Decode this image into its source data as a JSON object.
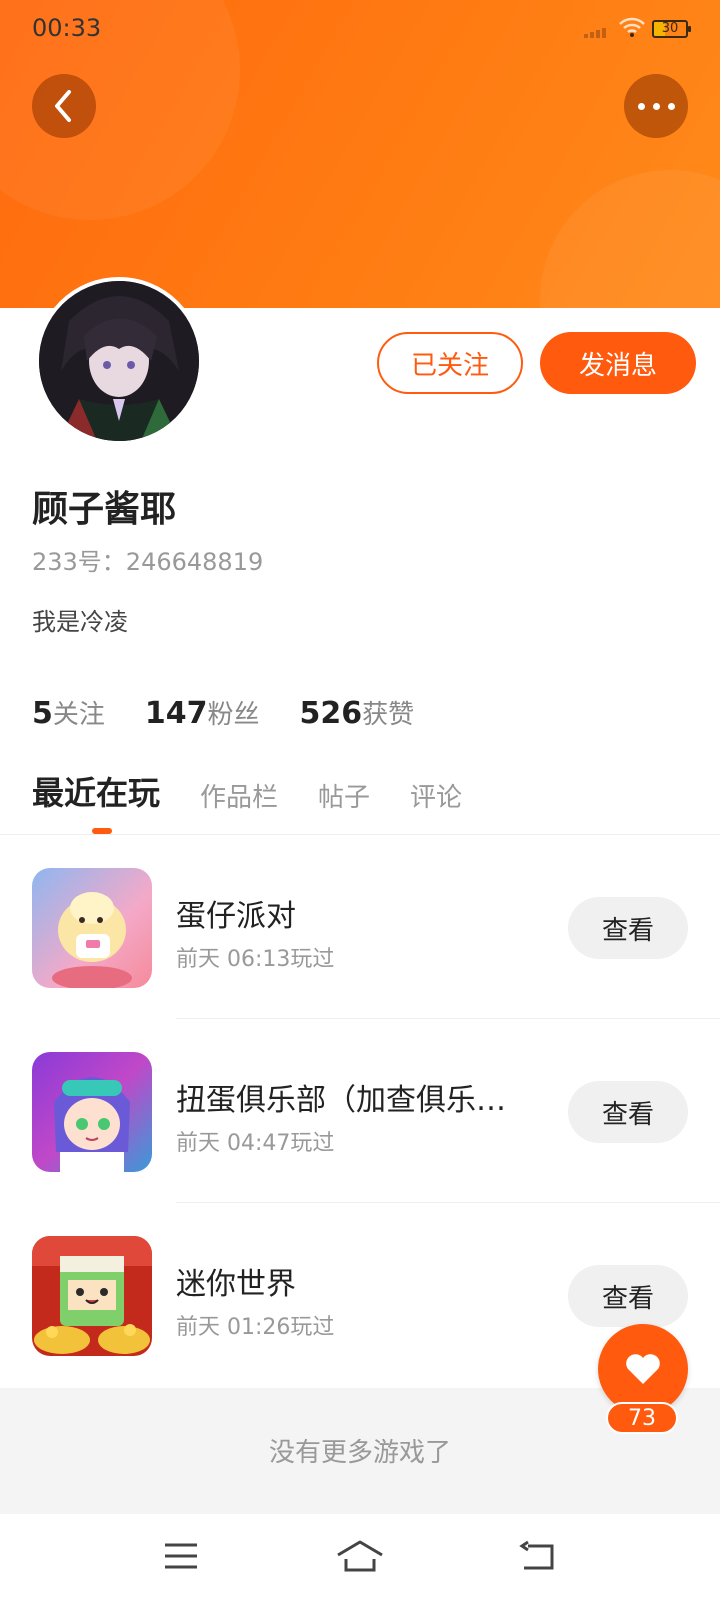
{
  "status_bar": {
    "time": "00:33",
    "battery": "30"
  },
  "header": {
    "back_icon": "chevron-left-icon",
    "more_icon": "more-horizontal-icon",
    "accent": "#ff5a0e"
  },
  "profile": {
    "name": "顾子酱耶",
    "uid": "233号：246648819",
    "bio": "我是冷凌",
    "follow_button": "已关注",
    "message_button": "发消息",
    "stats": [
      {
        "value": "5",
        "label": "关注"
      },
      {
        "value": "147",
        "label": "粉丝"
      },
      {
        "value": "526",
        "label": "获赞"
      }
    ]
  },
  "tabs": [
    {
      "label": "最近在玩",
      "active": true
    },
    {
      "label": "作品栏",
      "active": false
    },
    {
      "label": "帖子",
      "active": false
    },
    {
      "label": "评论",
      "active": false
    }
  ],
  "games": [
    {
      "name": "蛋仔派对",
      "played": "前天 06:13玩过",
      "action": "查看"
    },
    {
      "name": "扭蛋俱乐部（加查俱乐…",
      "played": "前天 04:47玩过",
      "action": "查看"
    },
    {
      "name": "迷你世界",
      "played": "前天 01:26玩过",
      "action": "查看"
    }
  ],
  "footer": {
    "no_more": "没有更多游戏了"
  },
  "like": {
    "count": "73",
    "icon": "heart-icon"
  },
  "nav": {
    "menu_icon": "menu-icon",
    "home_icon": "home-icon",
    "back_icon": "back-icon"
  }
}
